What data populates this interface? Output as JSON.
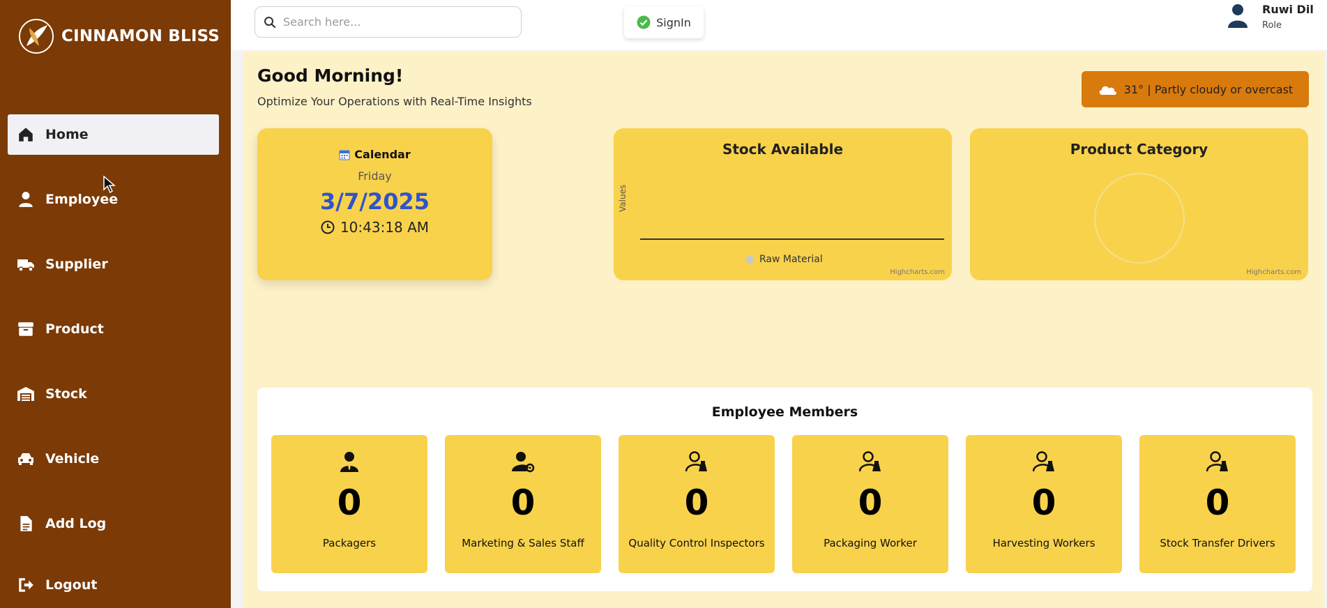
{
  "brand": {
    "name": "CINNAMON BLISS"
  },
  "sidebar": {
    "items": [
      {
        "label": "Home",
        "icon": "home-icon",
        "active": true
      },
      {
        "label": "Employee",
        "icon": "user-icon"
      },
      {
        "label": "Supplier",
        "icon": "truck-icon"
      },
      {
        "label": "Product",
        "icon": "box-icon"
      },
      {
        "label": "Stock",
        "icon": "warehouse-icon"
      },
      {
        "label": "Vehicle",
        "icon": "car-icon"
      },
      {
        "label": "Add Log",
        "icon": "file-icon"
      },
      {
        "label": "Logout",
        "icon": "logout-icon"
      }
    ]
  },
  "topbar": {
    "search_placeholder": "Search here...",
    "signin_label": "SignIn",
    "user_name": "Ruwi Dil",
    "user_role": "Role"
  },
  "main": {
    "greeting": "Good Morning!",
    "subtitle": "Optimize Your Operations with Real-Time Insights",
    "weather": "31° | Partly cloudy or overcast"
  },
  "calendar": {
    "title": "Calendar",
    "day": "Friday",
    "date": "3/7/2025",
    "time": "10:43:18 AM"
  },
  "stock_chart": {
    "title": "Stock Available",
    "ylabel": "Values",
    "legend": "Raw Material",
    "credit": "Highcharts.com"
  },
  "category_chart": {
    "title": "Product Category",
    "credit": "Highcharts.com"
  },
  "members": {
    "title": "Employee Members",
    "items": [
      {
        "label": "Packagers",
        "count": "0"
      },
      {
        "label": "Marketing & Sales Staff",
        "count": "0"
      },
      {
        "label": "Quality Control Inspectors",
        "count": "0"
      },
      {
        "label": "Packaging Worker",
        "count": "0"
      },
      {
        "label": "Harvesting Workers",
        "count": "0"
      },
      {
        "label": "Stock Transfer Drivers",
        "count": "0"
      }
    ]
  },
  "colors": {
    "sidebar": "#7b3a06",
    "main_bg": "#fdf1c7",
    "card": "#f9d24c",
    "weather": "#d97a0c",
    "date": "#2f54c9"
  }
}
